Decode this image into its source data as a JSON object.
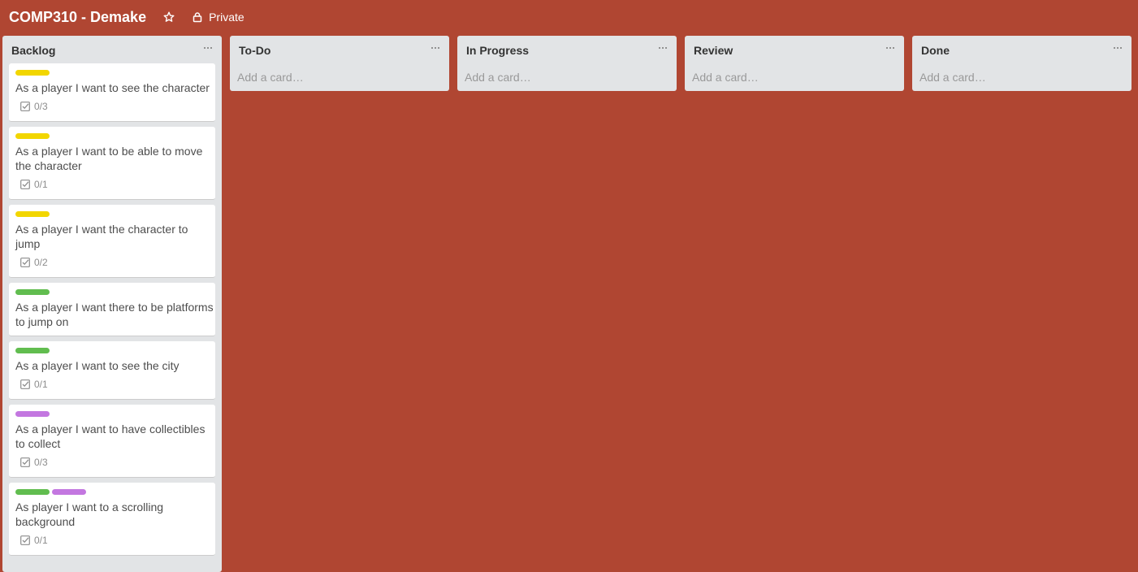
{
  "board": {
    "title": "COMP310 - Demake",
    "privacy": "Private",
    "background_color": "#b04632"
  },
  "icons": {
    "star": "star-icon",
    "lock": "lock-icon",
    "menu": "ellipsis-icon",
    "checklist": "checklist-icon"
  },
  "label_colors": {
    "yellow": "#f2d600",
    "green": "#61bd4f",
    "purple": "#c377e0"
  },
  "lists": [
    {
      "title": "Backlog",
      "cards": [
        {
          "labels": [
            "yellow"
          ],
          "title": "As a player I want to see the character",
          "checklist": "0/3"
        },
        {
          "labels": [
            "yellow"
          ],
          "title": "As a player I want to be able to move the character",
          "checklist": "0/1"
        },
        {
          "labels": [
            "yellow"
          ],
          "title": "As a player I want the character to jump",
          "checklist": "0/2"
        },
        {
          "labels": [
            "green"
          ],
          "title": "As a player I want there to be platforms to jump on",
          "checklist": ""
        },
        {
          "labels": [
            "green"
          ],
          "title": "As a player I want to see the city",
          "checklist": "0/1"
        },
        {
          "labels": [
            "purple"
          ],
          "title": "As a player I want to have collectibles to collect",
          "checklist": "0/3"
        },
        {
          "labels": [
            "green",
            "purple"
          ],
          "title": "As player I want to a scrolling background",
          "checklist": "0/1"
        }
      ]
    },
    {
      "title": "To-Do",
      "add_card": "Add a card…"
    },
    {
      "title": "In Progress",
      "add_card": "Add a card…"
    },
    {
      "title": "Review",
      "add_card": "Add a card…"
    },
    {
      "title": "Done",
      "add_card": "Add a card…"
    }
  ]
}
